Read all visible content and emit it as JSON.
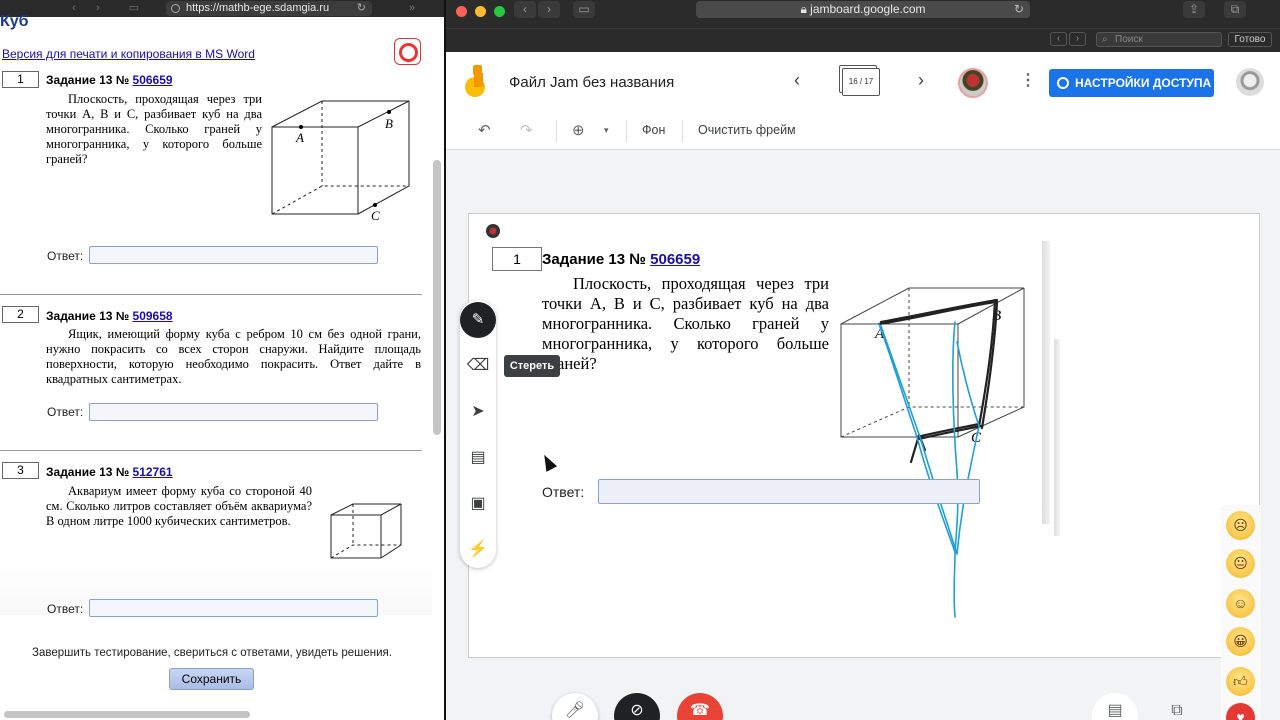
{
  "left_browser": {
    "url": "https://mathb-ege.sdamgia.ru",
    "page_title": "Куб",
    "print_link": "Версия для печати и копирования в MS Word",
    "tasks": [
      {
        "num": "1",
        "title_prefix": "Задание 13 №",
        "id": "506659",
        "text": "Плоскость, проходящая через три точки A, B и C, разбивает куб на два многогранника. Сколько граней у многогранника, у которого больше граней?",
        "answer_label": "Ответ:"
      },
      {
        "num": "2",
        "title_prefix": "Задание 13 №",
        "id": "509658",
        "text": "Ящик, имеющий форму куба с ребром 10 см без одной грани, нужно покрасить со всех сторон снаружи. Найдите площадь поверхности, которую необходимо покрасить. Ответ дайте в квадратных сантиметрах.",
        "answer_label": "Ответ:"
      },
      {
        "num": "3",
        "title_prefix": "Задание 13 №",
        "id": "512761",
        "text": "Аквариум имеет форму куба со стороной 40 см. Сколько литров составляет объём аквариума? В одном литре 1000 кубических сантиметров.",
        "answer_label": "Ответ:"
      }
    ],
    "figure_labels": {
      "a": "A",
      "b": "B",
      "c": "C"
    },
    "finish_text": "Завершить тестирование, свериться с ответами, увидеть решения.",
    "save_button": "Сохранить"
  },
  "right_browser": {
    "url": "jamboard.google.com",
    "search_placeholder": "Поиск",
    "done_button": "Готово",
    "jam": {
      "title": "Файл Jam без названия",
      "frame_indicator": "16 / 17",
      "share_button": "НАСТРОЙКИ ДОСТУПА",
      "toolbar": {
        "background": "Фон",
        "clear_frame": "Очистить фрейм"
      },
      "tooltip": "Стереть",
      "canvas_task": {
        "num": "1",
        "title_prefix": "Задание 13 №",
        "id": "506659",
        "text": "Плоскость, проходящая через три точки A, B и C, разбивает куб на два многогранника. Сколько граней у многогранника, у которого больше граней?",
        "answer_label": "Ответ:"
      }
    }
  },
  "colors": {
    "link": "#1a0dab",
    "share_button": "#1a73e8",
    "ink_black": "#222222",
    "ink_cyan": "#1f9fd6"
  },
  "icons": [
    "back-icon",
    "forward-icon",
    "sidebar-icon",
    "reload-icon",
    "lock-icon",
    "lifebuoy-icon",
    "undo-icon",
    "redo-icon",
    "zoom-icon",
    "pen-icon",
    "eraser-icon",
    "select-icon",
    "sticky-note-icon",
    "image-icon",
    "laser-icon",
    "chevron-left-icon",
    "chevron-right-icon",
    "more-vert-icon",
    "globe-icon",
    "mic-icon",
    "camera-off-icon",
    "hangup-icon"
  ]
}
